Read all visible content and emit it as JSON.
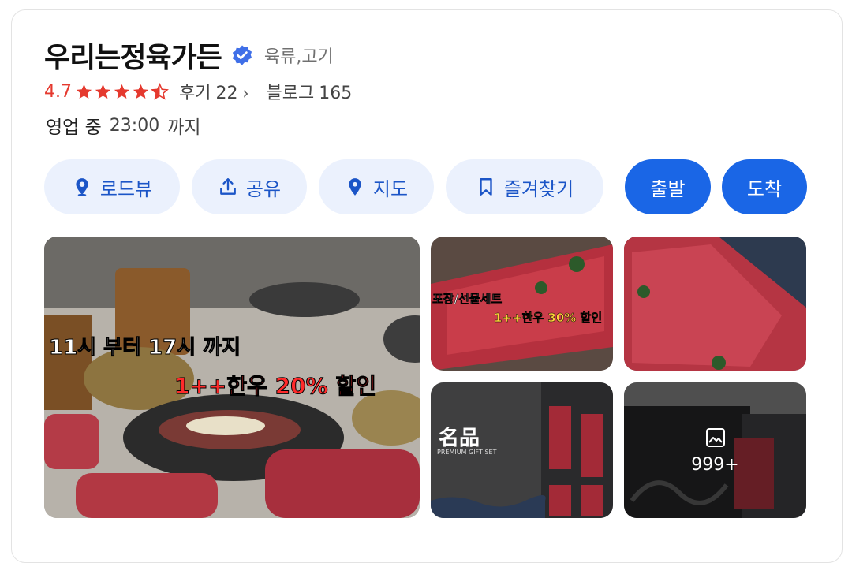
{
  "place": {
    "name": "우리는정육가든",
    "category": "육류,고기",
    "rating": "4.7",
    "stars_filled": 4.5,
    "reviews_label": "후기",
    "reviews_count": "22",
    "blog_label": "블로그",
    "blog_count": "165",
    "hours_status": "영업 중",
    "hours_time": "23:00",
    "hours_suffix": "까지"
  },
  "actions": {
    "roadview": "로드뷰",
    "share": "공유",
    "map": "지도",
    "bookmark": "즐겨찾기",
    "depart": "출발",
    "arrive": "도착"
  },
  "photos": {
    "main_line1": "11시 부터 17시 까지",
    "main_line2": "1++한우 20% 할인",
    "top_mid_line1": "포장/선물세트",
    "top_mid_line2": "1++한우 30% 할인",
    "bottom_mid_brand": "名品",
    "bottom_mid_sub": "PREMIUM GIFT SET",
    "more_count": "999+"
  },
  "colors": {
    "accent": "#1a66e6",
    "light_button": "#ebf1fd",
    "rating": "#e5392e",
    "verified": "#3f6fe8"
  }
}
